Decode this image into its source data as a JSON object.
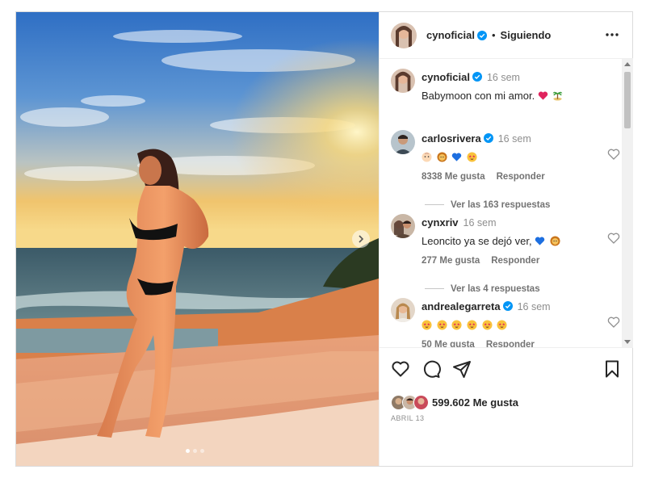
{
  "header": {
    "username": "cynoficial",
    "separator": "•",
    "follow_status": "Siguiendo"
  },
  "caption": {
    "username": "cynoficial",
    "time": "16 sem",
    "text": "Babymoon con mi amor.",
    "emojis": [
      "red-heart",
      "palm-tree-island"
    ]
  },
  "comments": [
    {
      "username": "carlosrivera",
      "verified": true,
      "time": "16 sem",
      "emojis": [
        "baby-face",
        "lion-face",
        "blue-heart",
        "star-struck-face"
      ],
      "likes": "8338 Me gusta",
      "reply_label": "Responder",
      "view_replies": "Ver las 163 respuestas"
    },
    {
      "username": "cynxriv",
      "verified": false,
      "time": "16 sem",
      "text": "Leoncito ya se dejó ver,",
      "emojis": [
        "blue-heart",
        "lion-face"
      ],
      "likes": "277 Me gusta",
      "reply_label": "Responder",
      "view_replies": "Ver las 4 respuestas"
    },
    {
      "username": "andrealegarreta",
      "verified": true,
      "time": "16 sem",
      "emojis": [
        "star-struck-face",
        "star-struck-face",
        "star-struck-face",
        "star-struck-face",
        "star-struck-face",
        "star-struck-face"
      ],
      "likes": "50 Me gusta",
      "reply_label": "Responder"
    }
  ],
  "footer": {
    "likes": "599.602 Me gusta",
    "date": "ABRIL 13"
  },
  "colors": {
    "verified_blue": "#0095f6",
    "muted_text": "#737373",
    "border": "#dbdbdb"
  },
  "icons": {
    "like": "heart-icon",
    "comment": "comment-bubble-icon",
    "share": "paper-plane-icon",
    "save": "bookmark-icon",
    "more": "more-options-icon",
    "carousel_next": "chevron-right-icon"
  },
  "carousel": {
    "slides": 3,
    "active_index": 1
  }
}
